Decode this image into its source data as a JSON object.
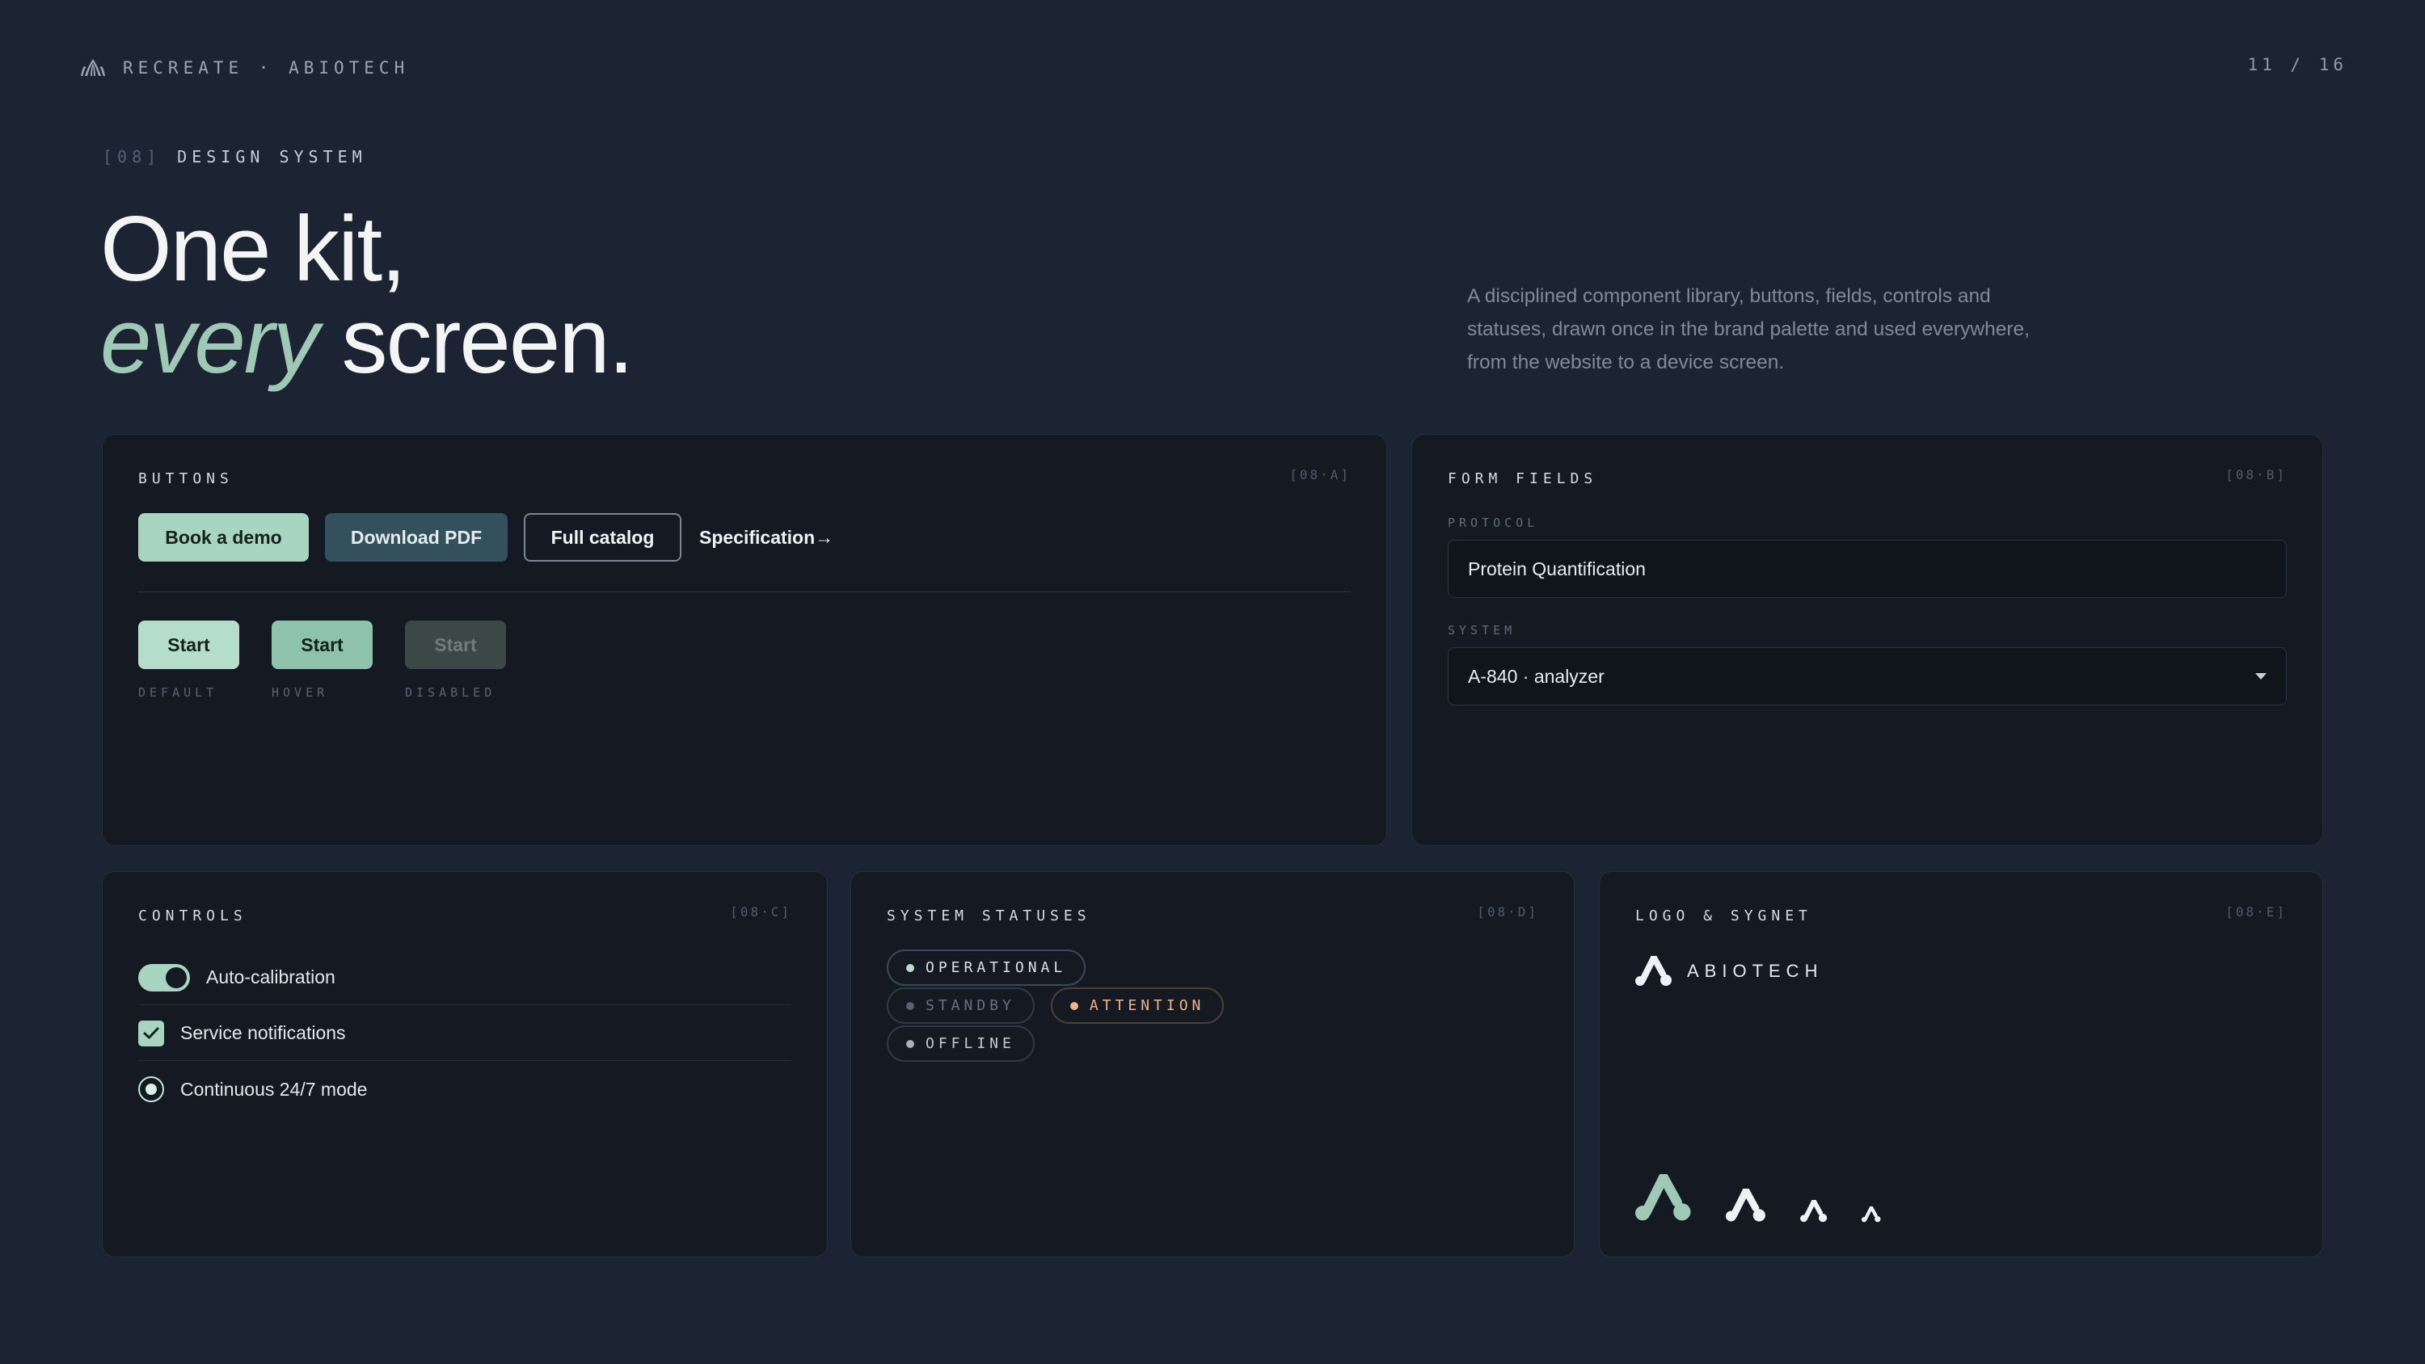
{
  "header": {
    "brand": "RECREATE · ABIOTECH",
    "page_counter": "11 / 16"
  },
  "section": {
    "number": "[08]",
    "title": "DESIGN SYSTEM"
  },
  "hero": {
    "line1": "One kit,",
    "accent_word": "every",
    "line2_rest": "screen.",
    "description": "A disciplined component library, buttons, fields, controls and statuses, drawn once in the brand palette and used everywhere, from the website to a device screen."
  },
  "buttons_card": {
    "title": "BUTTONS",
    "code": "[08·A]",
    "primary": "Book a demo",
    "secondary": "Download PDF",
    "outline": "Full catalog",
    "link": "Specification→",
    "states": [
      {
        "label": "Start",
        "caption": "DEFAULT"
      },
      {
        "label": "Start",
        "caption": "HOVER"
      },
      {
        "label": "Start",
        "caption": "DISABLED"
      }
    ]
  },
  "form_card": {
    "title": "FORM FIELDS",
    "code": "[08·B]",
    "protocol_label": "PROTOCOL",
    "protocol_value": "Protein Quantification",
    "system_label": "SYSTEM",
    "system_value": "A-840 · analyzer"
  },
  "controls_card": {
    "title": "CONTROLS",
    "code": "[08·C]",
    "toggle_label": "Auto-calibration",
    "toggle_on": true,
    "checkbox_label": "Service notifications",
    "checkbox_checked": true,
    "radio_label": "Continuous 24/7 mode",
    "radio_selected": true
  },
  "status_card": {
    "title": "SYSTEM STATUSES",
    "code": "[08·D]",
    "statuses": [
      "OPERATIONAL",
      "STANDBY",
      "ATTENTION",
      "OFFLINE"
    ]
  },
  "logo_card": {
    "title": "LOGO & SYGNET",
    "code": "[08·E]",
    "wordmark": "ABIOTECH"
  },
  "colors": {
    "background": "#1c2433",
    "card": "#151a22",
    "mint": "#a8d4c2",
    "slate": "#34505c",
    "attention": "#f0b38e"
  }
}
